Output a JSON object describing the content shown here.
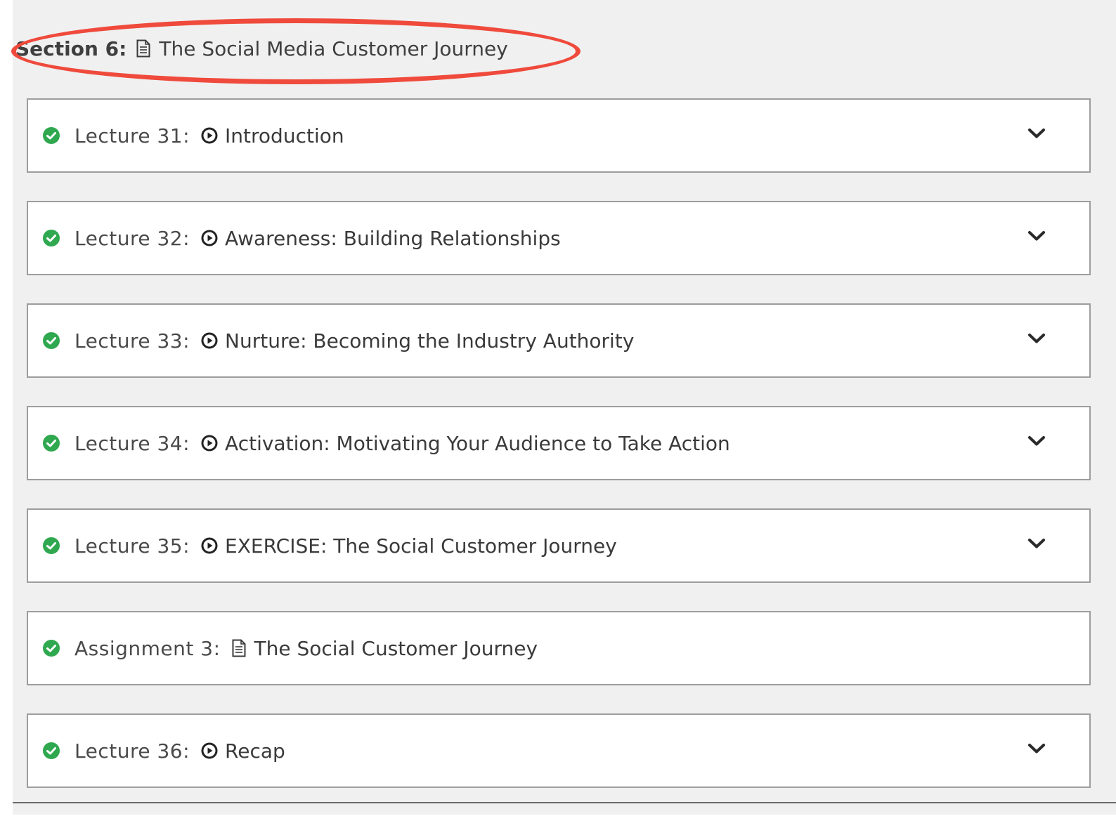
{
  "section": {
    "label": "Section 6:",
    "title": "The Social Media Customer Journey",
    "icon": "document-icon"
  },
  "colors": {
    "background": "#f0f0f0",
    "card_background": "#ffffff",
    "card_border": "#9d9d9d",
    "complete_check": "#2fa84f",
    "annotation": "#ef4a3c"
  },
  "lectures": [
    {
      "label": "Lecture 31:",
      "title": "Introduction",
      "type_icon": "play-circle-icon",
      "status_icon": "check-circle-icon",
      "expandable": true
    },
    {
      "label": "Lecture 32:",
      "title": "Awareness: Building Relationships",
      "type_icon": "play-circle-icon",
      "status_icon": "check-circle-icon",
      "expandable": true
    },
    {
      "label": "Lecture 33:",
      "title": "Nurture: Becoming the Industry Authority",
      "type_icon": "play-circle-icon",
      "status_icon": "check-circle-icon",
      "expandable": true
    },
    {
      "label": "Lecture 34:",
      "title": "Activation: Motivating Your Audience to Take Action",
      "type_icon": "play-circle-icon",
      "status_icon": "check-circle-icon",
      "expandable": true
    },
    {
      "label": "Lecture 35:",
      "title": "EXERCISE: The Social Customer Journey",
      "type_icon": "play-circle-icon",
      "status_icon": "check-circle-icon",
      "expandable": true
    },
    {
      "label": "Assignment 3:",
      "title": "The Social Customer Journey",
      "type_icon": "document-icon",
      "status_icon": "check-circle-icon",
      "expandable": false
    },
    {
      "label": "Lecture 36:",
      "title": "Recap",
      "type_icon": "play-circle-icon",
      "status_icon": "check-circle-icon",
      "expandable": true
    }
  ]
}
